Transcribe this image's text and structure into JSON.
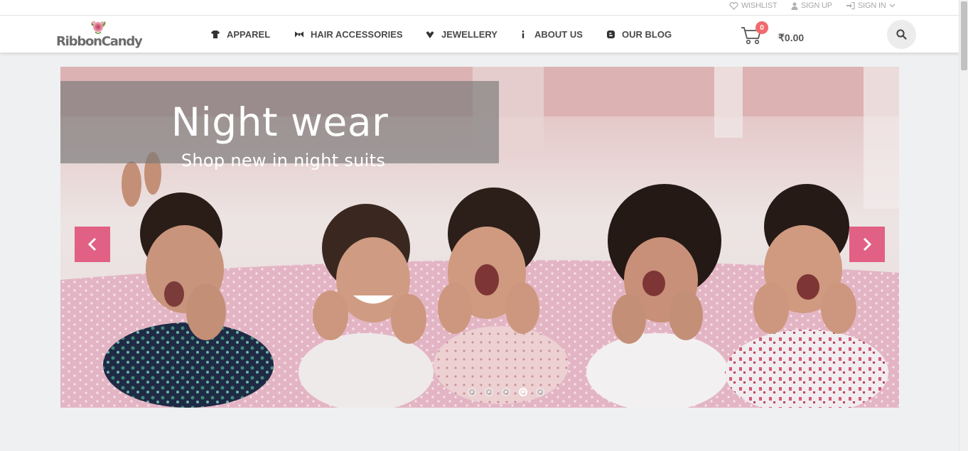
{
  "topbar": {
    "wishlist": "WISHLIST",
    "signup": "SIGN UP",
    "signin": "SIGN IN"
  },
  "brand": {
    "name": "RibbonCandy"
  },
  "nav": {
    "items": [
      {
        "label": "APPAREL",
        "icon": "tshirt-icon"
      },
      {
        "label": "HAIR ACCESSORIES",
        "icon": "bow-icon"
      },
      {
        "label": "JEWELLERY",
        "icon": "gem-icon"
      },
      {
        "label": "ABOUT US",
        "icon": "info-icon"
      },
      {
        "label": "OUR BLOG",
        "icon": "blogger-icon"
      }
    ]
  },
  "cart": {
    "count": "0",
    "total": "₹0.00"
  },
  "slider": {
    "title": "Night wear",
    "subtitle": "Shop new in night suits",
    "slide_count": 5,
    "active_slide": 4
  },
  "colors": {
    "accent_pink": "#e1567d",
    "badge_red": "#f16a6e",
    "page_bg": "#eff0f2"
  }
}
